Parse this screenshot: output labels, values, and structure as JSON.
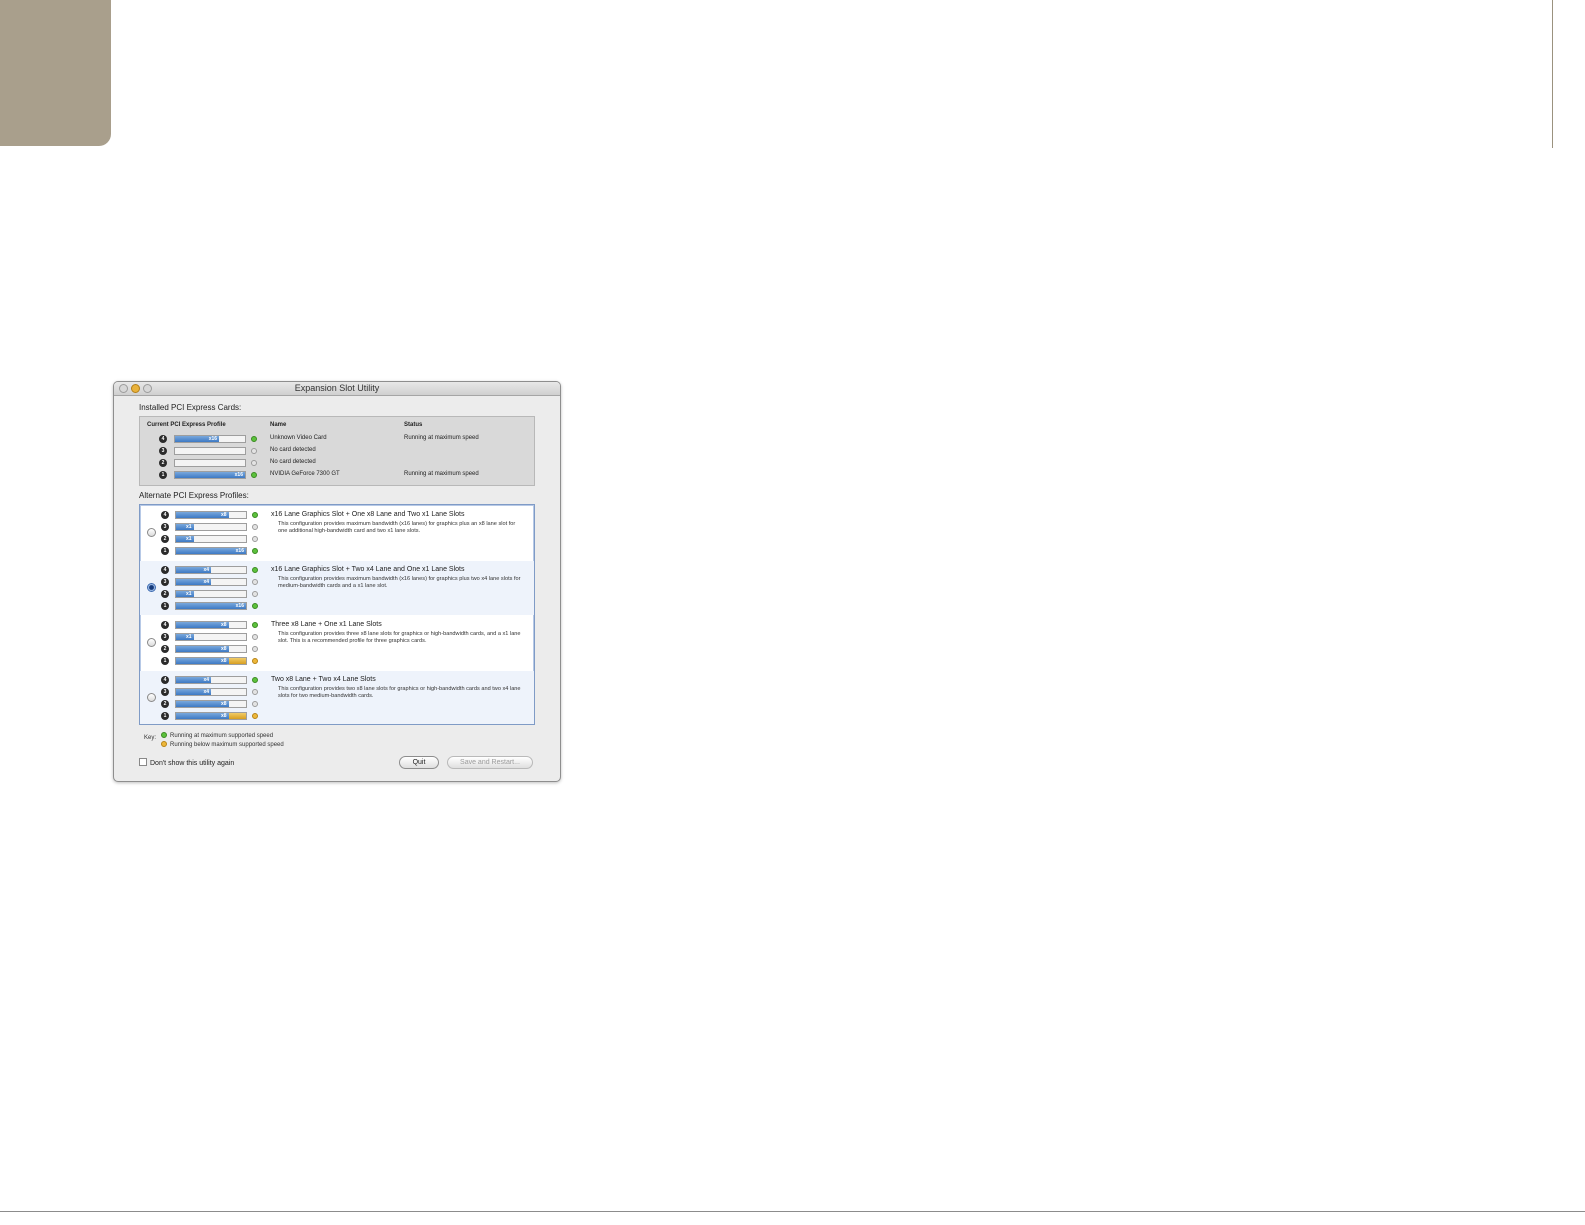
{
  "window": {
    "title": "Expansion Slot Utility"
  },
  "installed": {
    "section_label": "Installed PCI Express Cards:",
    "headers": {
      "profile": "Current PCI Express Profile",
      "name": "Name",
      "status": "Status"
    },
    "rows": [
      {
        "slot": "4",
        "lane": "x16",
        "fill": 0.63,
        "dot": "green",
        "name": "Unknown Video Card",
        "status": "Running at maximum speed"
      },
      {
        "slot": "3",
        "lane": "",
        "fill": 0,
        "dot": "gray",
        "name": "No card detected",
        "status": ""
      },
      {
        "slot": "2",
        "lane": "",
        "fill": 0,
        "dot": "gray",
        "name": "No card detected",
        "status": ""
      },
      {
        "slot": "1",
        "lane": "x16",
        "fill": 1.0,
        "dot": "green",
        "name": "NVIDIA GeForce 7300 GT",
        "status": "Running at maximum speed"
      }
    ]
  },
  "profiles": {
    "section_label": "Alternate PCI Express Profiles:",
    "items": [
      {
        "selected": false,
        "title": "x16 Lane Graphics Slot + One x8 Lane and Two x1 Lane Slots",
        "description": "This configuration provides maximum bandwidth (x16 lanes) for graphics plus an x8 lane slot for one additional high-bandwidth card and two x1 lane slots.",
        "slots": [
          {
            "slot": "4",
            "lane": "x8",
            "fill": 0.75,
            "extra": 0,
            "dot": "green"
          },
          {
            "slot": "3",
            "lane": "x1",
            "fill": 0.25,
            "extra": 0,
            "dot": "gray"
          },
          {
            "slot": "2",
            "lane": "x1",
            "fill": 0.25,
            "extra": 0,
            "dot": "gray"
          },
          {
            "slot": "1",
            "lane": "x16",
            "fill": 1.0,
            "extra": 0,
            "dot": "green"
          }
        ]
      },
      {
        "selected": true,
        "title": "x16 Lane Graphics Slot + Two x4 Lane and One x1 Lane Slots",
        "description": "This configuration provides maximum bandwidth (x16 lanes) for graphics plus two x4 lane slots for medium-bandwidth cards and a x1 lane slot.",
        "slots": [
          {
            "slot": "4",
            "lane": "x4",
            "fill": 0.5,
            "extra": 0,
            "dot": "green"
          },
          {
            "slot": "3",
            "lane": "x4",
            "fill": 0.5,
            "extra": 0,
            "dot": "gray"
          },
          {
            "slot": "2",
            "lane": "x1",
            "fill": 0.25,
            "extra": 0,
            "dot": "gray"
          },
          {
            "slot": "1",
            "lane": "x16",
            "fill": 1.0,
            "extra": 0,
            "dot": "green"
          }
        ]
      },
      {
        "selected": false,
        "title": "Three x8 Lane + One x1 Lane Slots",
        "description": "This configuration provides three x8 lane slots for graphics or high-bandwidth cards, and a x1 lane slot.  This is a recommended profile for three graphics cards.",
        "slots": [
          {
            "slot": "4",
            "lane": "x8",
            "fill": 0.75,
            "extra": 0,
            "dot": "green"
          },
          {
            "slot": "3",
            "lane": "x1",
            "fill": 0.25,
            "extra": 0,
            "dot": "gray"
          },
          {
            "slot": "2",
            "lane": "x8",
            "fill": 0.75,
            "extra": 0,
            "dot": "gray"
          },
          {
            "slot": "1",
            "lane": "x8",
            "fill": 0.75,
            "extra": 0.25,
            "dot": "amber"
          }
        ]
      },
      {
        "selected": false,
        "title": "Two x8 Lane + Two x4 Lane Slots",
        "description": "This configuration provides two x8 lane slots for graphics or high-bandwidth cards and two x4 lane slots for two medium-bandwidth cards.",
        "slots": [
          {
            "slot": "4",
            "lane": "x4",
            "fill": 0.5,
            "extra": 0,
            "dot": "green"
          },
          {
            "slot": "3",
            "lane": "x4",
            "fill": 0.5,
            "extra": 0,
            "dot": "gray"
          },
          {
            "slot": "2",
            "lane": "x8",
            "fill": 0.75,
            "extra": 0,
            "dot": "gray"
          },
          {
            "slot": "1",
            "lane": "x8",
            "fill": 0.75,
            "extra": 0.25,
            "dot": "amber"
          }
        ]
      }
    ]
  },
  "key": {
    "label": "Key:",
    "max_speed": "Running at maximum supported speed",
    "below_speed": "Running below maximum supported speed"
  },
  "footer": {
    "dont_show_label": "Don't show this utility again",
    "quit_label": "Quit",
    "save_label": "Save and Restart..."
  }
}
